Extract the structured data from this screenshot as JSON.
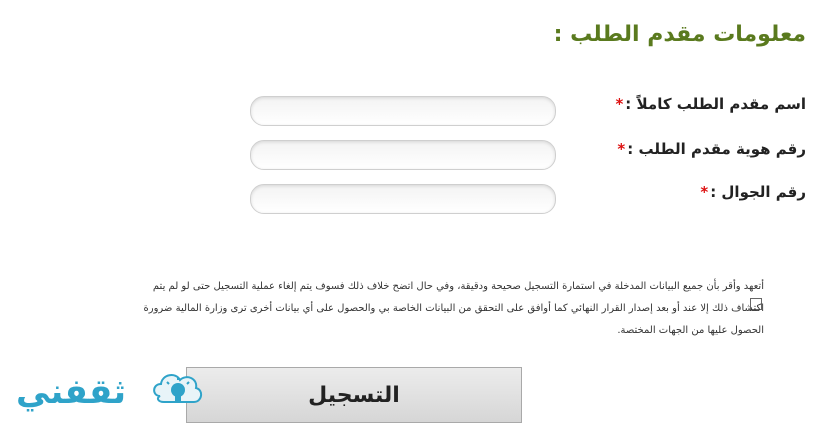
{
  "section": {
    "title": "معلومات مقدم الطلب :"
  },
  "fields": [
    {
      "label": "اسم مقدم الطلب كاملاً :",
      "required_mark": "*",
      "value": ""
    },
    {
      "label": "رقم هوية مقدم الطلب :",
      "required_mark": "*",
      "value": ""
    },
    {
      "label": "رقم الجوال :",
      "required_mark": "*",
      "value": ""
    }
  ],
  "agreement": {
    "line1": "أتعهد وأقر بأن جميع البيانات المدخلة في استمارة التسجيل صحيحة ودقيقة، وفي حال اتضح خلاف ذلك فسوف يتم إلغاء عملية التسجيل حتى لو لم يتم",
    "line2": "اكتشاف ذلك إلا عند أو بعد إصدار القرار النهائي كما أوافق على التحقق من البيانات الخاصة بي والحصول على أي بيانات أخرى ترى وزارة المالية ضرورة",
    "line3": "الحصول عليها من الجهات المختصة.",
    "checked": false
  },
  "submit": {
    "label": "التسجيل"
  },
  "logo": {
    "text": "ثقفني",
    "icon": "lightbulb-icon"
  },
  "colors": {
    "title": "#5a7a1e",
    "required": "#dd1111",
    "logo": "#2fa3c9"
  }
}
